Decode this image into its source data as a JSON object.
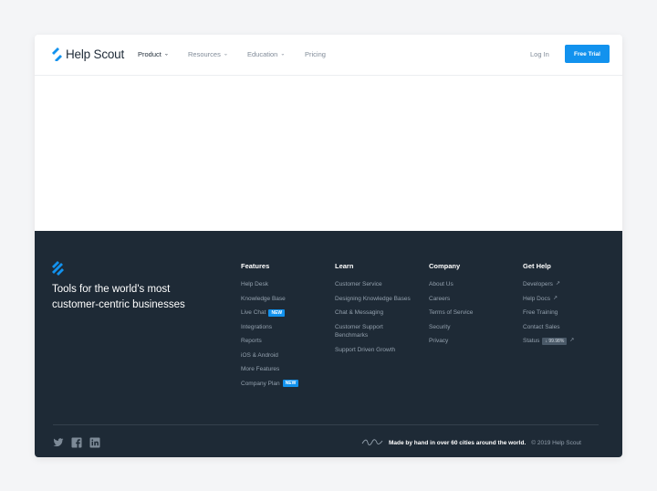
{
  "brand": {
    "name": "Help Scout",
    "accent": "#1292ee",
    "dark": "#1e2a36"
  },
  "nav": {
    "items": [
      {
        "label": "Product",
        "has_menu": true
      },
      {
        "label": "Resources",
        "has_menu": true
      },
      {
        "label": "Education",
        "has_menu": true
      },
      {
        "label": "Pricing",
        "has_menu": false
      }
    ],
    "login": "Log In",
    "cta": "Free Trial"
  },
  "footer": {
    "tagline": "Tools for the world's most customer-centric businesses",
    "columns": [
      {
        "title": "Features",
        "links": [
          {
            "label": "Help Desk"
          },
          {
            "label": "Knowledge Base"
          },
          {
            "label": "Live Chat",
            "badge": "NEW"
          },
          {
            "label": "Integrations"
          },
          {
            "label": "Reports"
          },
          {
            "label": "iOS & Android"
          },
          {
            "label": "More Features"
          },
          {
            "label": "Company Plan",
            "badge": "NEW"
          }
        ]
      },
      {
        "title": "Learn",
        "links": [
          {
            "label": "Customer Service"
          },
          {
            "label": "Designing Knowledge Bases"
          },
          {
            "label": "Chat & Messaging"
          },
          {
            "label": "Customer Support Benchmarks"
          },
          {
            "label": "Support Driven Growth"
          }
        ]
      },
      {
        "title": "Company",
        "links": [
          {
            "label": "About Us"
          },
          {
            "label": "Careers"
          },
          {
            "label": "Terms of Service"
          },
          {
            "label": "Security"
          },
          {
            "label": "Privacy"
          }
        ]
      },
      {
        "title": "Get Help",
        "links": [
          {
            "label": "Developers",
            "external": true
          },
          {
            "label": "Help Docs",
            "external": true
          },
          {
            "label": "Free Training"
          },
          {
            "label": "Contact Sales"
          },
          {
            "label": "Status",
            "status": "↓ 99.98%",
            "external": true
          }
        ]
      }
    ],
    "social": [
      "twitter-icon",
      "facebook-icon",
      "linkedin-icon"
    ],
    "made_by": "Made by hand in over 60 cities around the world.",
    "copyright": "© 2019 Help Scout"
  }
}
